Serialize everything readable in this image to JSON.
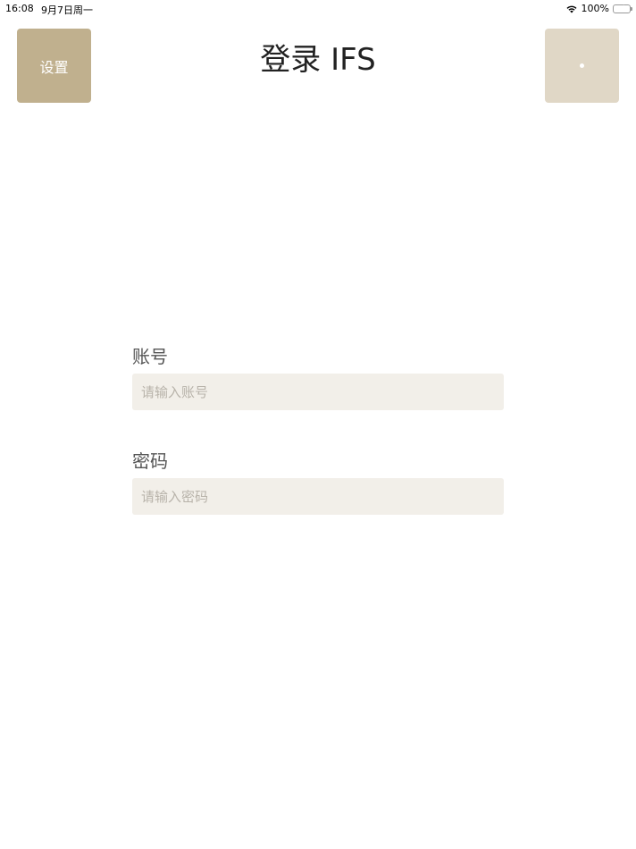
{
  "status_bar": {
    "time": "16:08",
    "date": "9月7日周一",
    "battery": "100%"
  },
  "header": {
    "settings_label": "设置",
    "title": "登录 IFS"
  },
  "form": {
    "account": {
      "label": "账号",
      "placeholder": "请输入账号"
    },
    "password": {
      "label": "密码",
      "placeholder": "请输入密码"
    }
  },
  "colors": {
    "settings_button": "#c0b08e",
    "right_button": "#e0d7c6",
    "input_background": "#f2efe9",
    "battery": "#34c759"
  },
  "icons": {
    "wifi": "wifi-icon",
    "battery": "battery-charging-icon",
    "right_button": "dot-icon"
  }
}
